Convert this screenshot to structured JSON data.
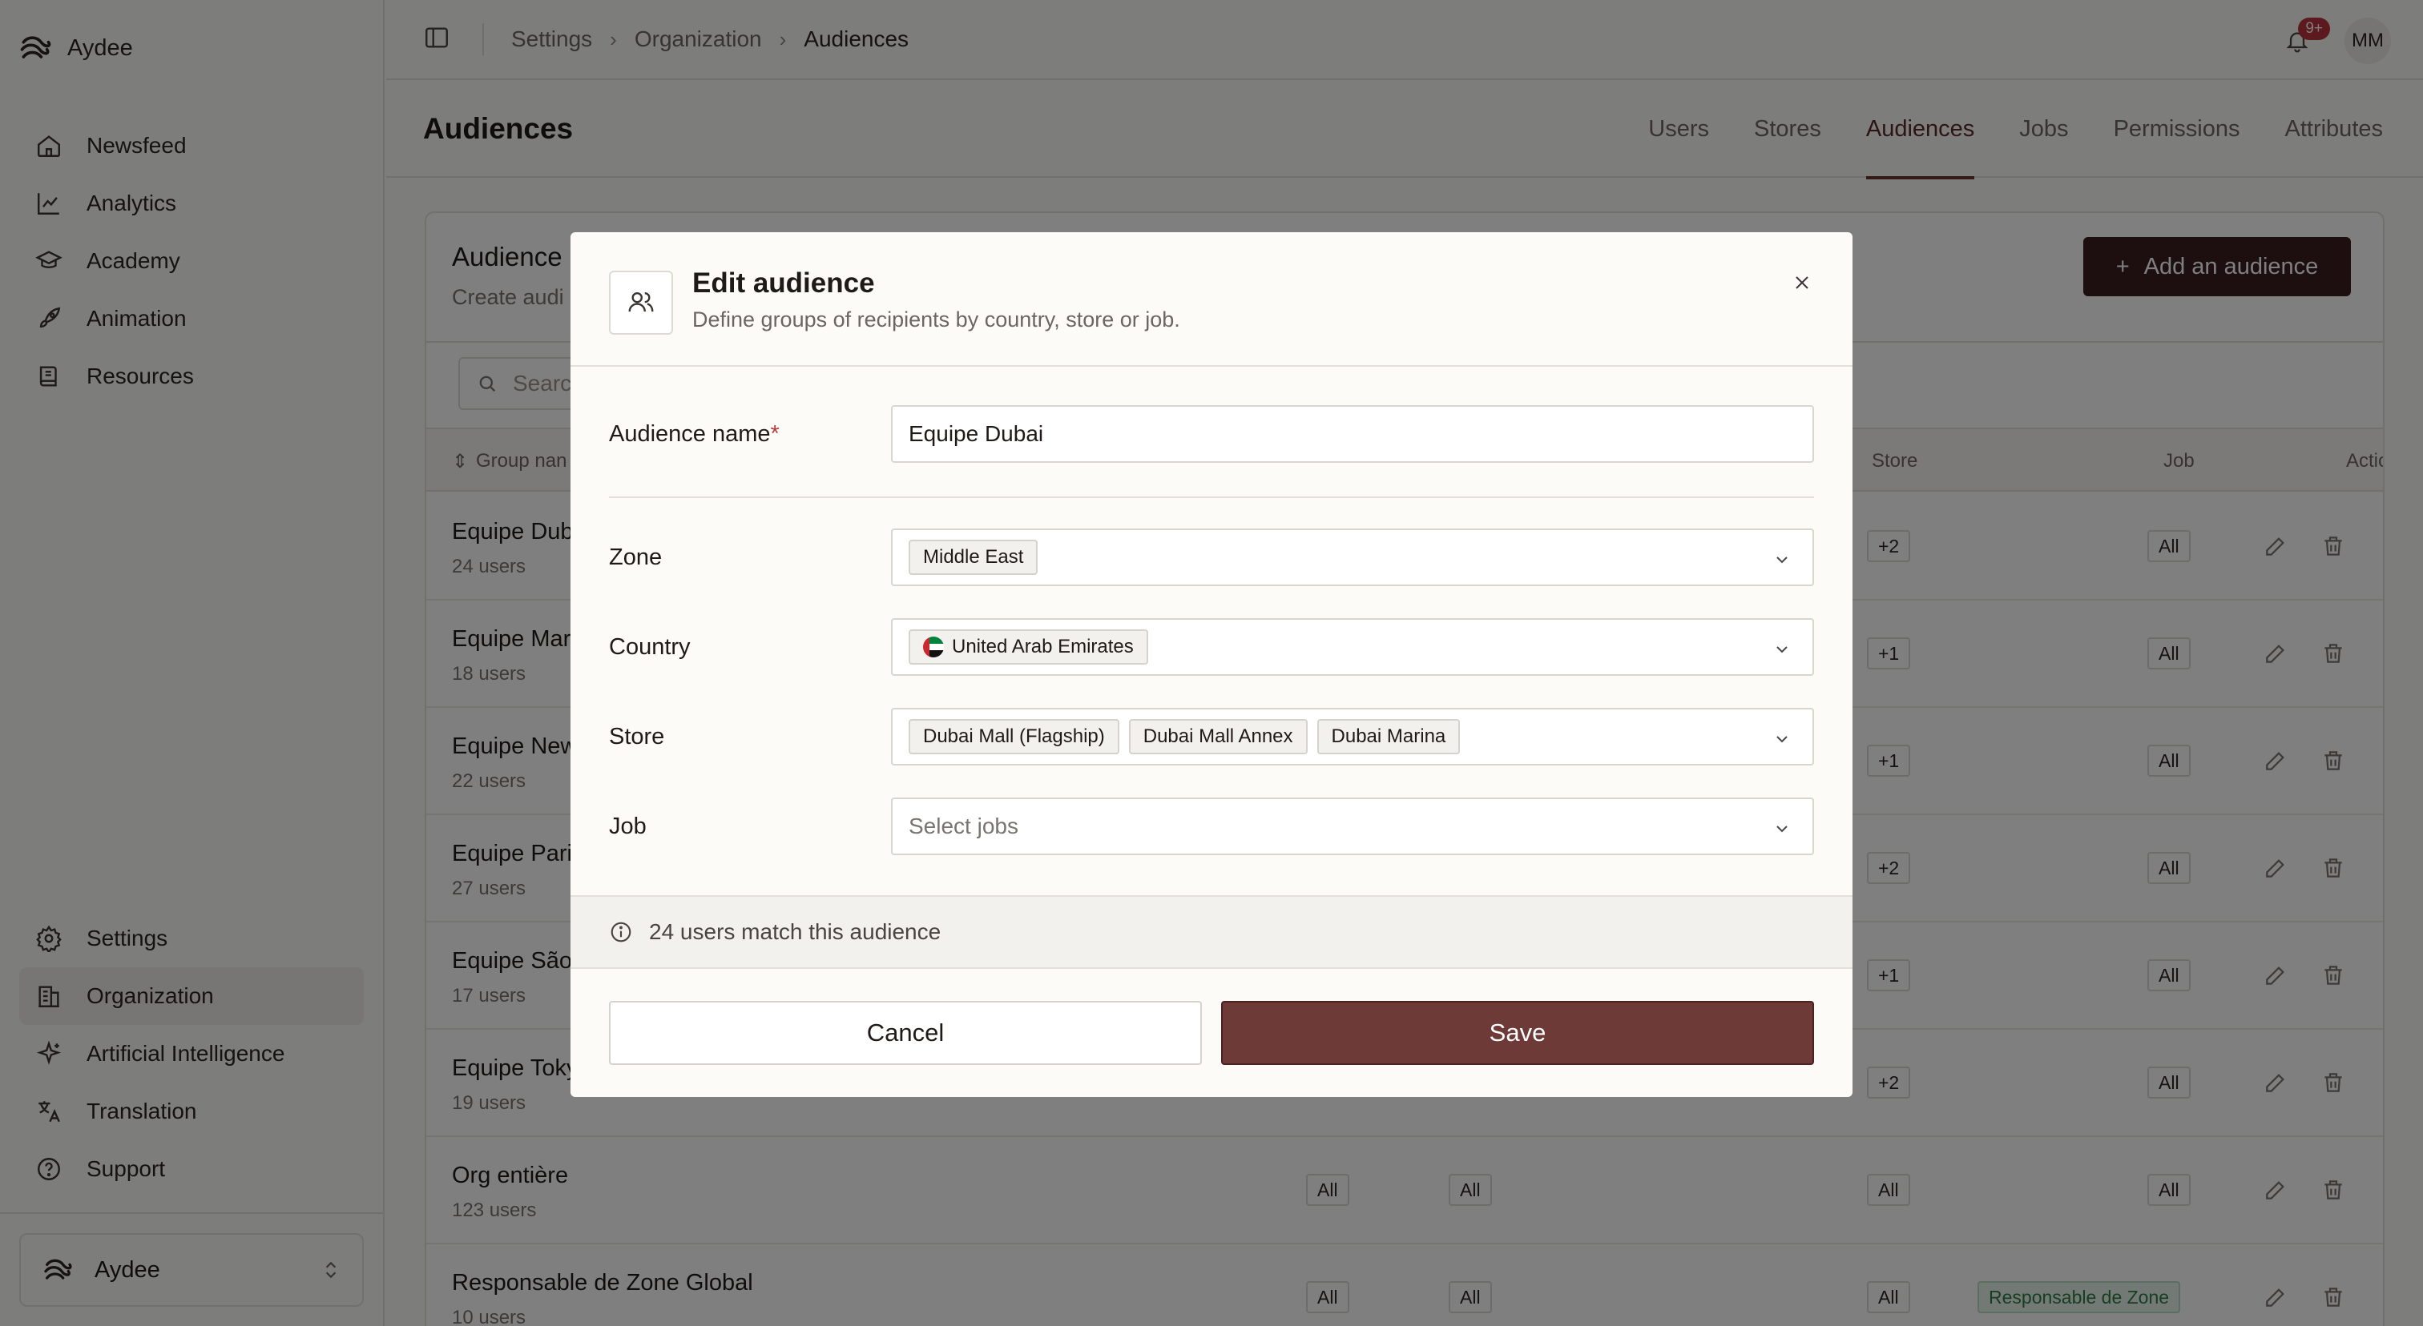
{
  "brand": {
    "name": "Aydee"
  },
  "sidebar": {
    "top_items": [
      {
        "label": "Newsfeed",
        "icon": "home-icon"
      },
      {
        "label": "Analytics",
        "icon": "chart-line-icon"
      },
      {
        "label": "Academy",
        "icon": "graduation-cap-icon"
      },
      {
        "label": "Animation",
        "icon": "rocket-icon"
      },
      {
        "label": "Resources",
        "icon": "book-icon"
      }
    ],
    "bottom_items": [
      {
        "label": "Settings",
        "icon": "gear-icon"
      },
      {
        "label": "Organization",
        "icon": "building-icon",
        "active": true
      },
      {
        "label": "Artificial Intelligence",
        "icon": "sparkles-icon"
      },
      {
        "label": "Translation",
        "icon": "translate-icon"
      },
      {
        "label": "Support",
        "icon": "help-circle-icon"
      }
    ],
    "workspace": "Aydee"
  },
  "header": {
    "breadcrumb": [
      "Settings",
      "Organization",
      "Audiences"
    ],
    "notification_badge": "9+",
    "avatar_initials": "MM"
  },
  "page": {
    "title": "Audiences",
    "tabs": [
      "Users",
      "Stores",
      "Audiences",
      "Jobs",
      "Permissions",
      "Attributes"
    ],
    "active_tab": "Audiences"
  },
  "card": {
    "title": "Audience",
    "subtitle": "Create audi",
    "add_button": "Add an audience",
    "search_placeholder": "Searc",
    "columns": {
      "group": "Group nan",
      "store": "Store",
      "job": "Job",
      "action": "Action"
    },
    "rows": [
      {
        "name": "Equipe Dub",
        "count": "24 users",
        "store": "+2",
        "job": "All"
      },
      {
        "name": "Equipe Mar",
        "count": "18 users",
        "store": "+1",
        "job": "All"
      },
      {
        "name": "Equipe New",
        "count": "22 users",
        "store": "+1",
        "job": "All"
      },
      {
        "name": "Equipe Pari",
        "count": "27 users",
        "store": "+2",
        "job": "All"
      },
      {
        "name": "Equipe São",
        "count": "17 users",
        "store": "+1",
        "job": "All"
      },
      {
        "name": "Equipe Toky",
        "count": "19 users",
        "store": "+2",
        "job": "All"
      },
      {
        "name": "Org entière",
        "count": "123 users",
        "zone": "All",
        "country": "All",
        "store": "All",
        "job": "All"
      },
      {
        "name": "Responsable de Zone Global",
        "count": "10 users",
        "zone": "All",
        "country": "All",
        "store": "All",
        "job": "Responsable de Zone"
      }
    ]
  },
  "modal": {
    "title": "Edit audience",
    "description": "Define groups of recipients by country, store or job.",
    "name_label": "Audience name",
    "required_mark": "*",
    "name_value": "Equipe Dubai",
    "zone_label": "Zone",
    "zone_tags": [
      "Middle East"
    ],
    "country_label": "Country",
    "country_tags": [
      "United Arab Emirates"
    ],
    "store_label": "Store",
    "store_tags": [
      "Dubai Mall (Flagship)",
      "Dubai Mall Annex",
      "Dubai Marina"
    ],
    "job_label": "Job",
    "job_placeholder": "Select jobs",
    "match_info": "24 users match this audience",
    "cancel_label": "Cancel",
    "save_label": "Save"
  },
  "colors": {
    "primary": "#6e3a38",
    "primary_dark": "#3a1e1e",
    "badge": "#b9343c",
    "success_chip": "#2e7a45"
  }
}
